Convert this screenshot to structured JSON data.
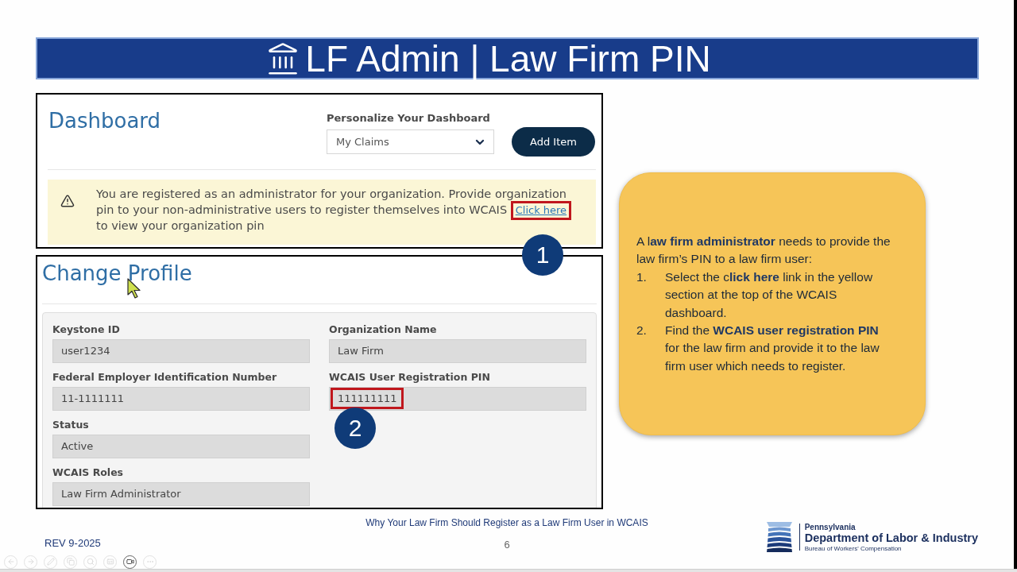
{
  "title_bar": {
    "title": "LF Admin | Law Firm PIN"
  },
  "dashboard": {
    "heading": "Dashboard",
    "personalize": {
      "label": "Personalize Your Dashboard",
      "value": "My Claims"
    },
    "add_button": "Add Item",
    "alert": {
      "text": "You are registered as an administrator for your organization. Provide organization pin to your non-administrative users to register themselves into WCAIS",
      "link": {
        "label": "Click here",
        "highlighted": true,
        "badge": "1"
      },
      "text_after": "to view your organization pin"
    }
  },
  "profile": {
    "heading": "Change Profile",
    "left_column": [
      {
        "label": "Keystone ID",
        "value": "user1234",
        "highlighted": false
      },
      {
        "label": "Federal Employer Identification Number",
        "value": "11-1111111",
        "highlighted": false
      },
      {
        "label": "Status",
        "value": "Active",
        "highlighted": false
      },
      {
        "label": "WCAIS Roles",
        "value": "Law Firm Administrator",
        "highlighted": false
      }
    ],
    "right_column": [
      {
        "label": "Organization Name",
        "value": "Law Firm",
        "highlighted": false
      },
      {
        "label": "WCAIS User Registration PIN",
        "value": "111111111",
        "highlighted": true,
        "badge": "2"
      }
    ]
  },
  "callout": {
    "intro": "A l**aw firm administrator** needs to provide the law firm’s PIN to a law firm user:",
    "steps": [
      {
        "number": "1.",
        "text": "Select the c**lick here** link in the yellow section at the top of the WCAIS dashboard."
      },
      {
        "number": "2.",
        "text": "Find the **WCAIS user registration PIN** for the law firm and provide it to the law firm user which needs to register."
      }
    ]
  },
  "footer": {
    "presentation_title": "Why Your Law Firm Should Register as a Law Firm User in WCAIS",
    "revision": "REV 9-2025",
    "page_number": "6",
    "logo": {
      "state": "Pennsylvania",
      "department": "Department of Labor & Industry",
      "bureau": "Bureau of Workers' Compensation"
    }
  },
  "player_controls": [
    {
      "kind": "previous",
      "disabled": true
    },
    {
      "kind": "next",
      "disabled": true
    },
    {
      "kind": "pen",
      "disabled": true
    },
    {
      "kind": "copy",
      "disabled": true
    },
    {
      "kind": "zoom",
      "disabled": true
    },
    {
      "kind": "captions",
      "disabled": true
    },
    {
      "kind": "camera",
      "disabled": false
    },
    {
      "kind": "more",
      "disabled": true
    }
  ]
}
